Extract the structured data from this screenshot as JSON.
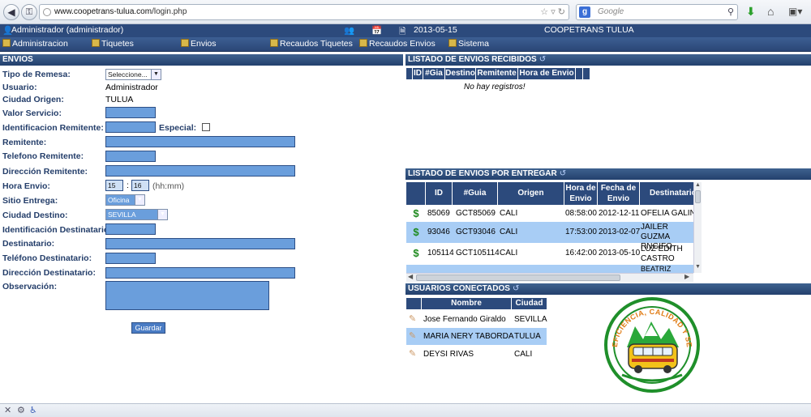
{
  "browser": {
    "url_host": "www.coopetrans-tulua.com",
    "url_path": "/login.php",
    "search_placeholder": "Google",
    "search_engine_letter": "g"
  },
  "header": {
    "user": "Administrador (administrador)",
    "date": "2013-05-15",
    "company": "COOPETRANS TULUA"
  },
  "menu": {
    "items": [
      {
        "label": "Administracion"
      },
      {
        "label": "Tiquetes"
      },
      {
        "label": "Envios"
      },
      {
        "label": "Recaudos Tiquetes"
      },
      {
        "label": "Recaudos Envios"
      },
      {
        "label": "Sistema"
      }
    ]
  },
  "form": {
    "title": "ENVIOS",
    "tipo_remesa_label": "Tipo de Remesa:",
    "tipo_remesa_value": "Seleccione...",
    "usuario_label": "Usuario:",
    "usuario_value": "Administrador",
    "ciudad_origen_label": "Ciudad Origen:",
    "ciudad_origen_value": "TULUA",
    "valor_servicio_label": "Valor Servicio:",
    "identificacion_remitente_label": "Identificacion Remitente:",
    "especial_label": "Especial:",
    "remitente_label": "Remitente:",
    "telefono_remitente_label": "Telefono Remitente:",
    "direccion_remitente_label": "Dirección Remitente:",
    "hora_envio_label": "Hora Envio:",
    "hora_value": "15",
    "minuto_value": "16",
    "hora_separator": ":",
    "hora_format": "(hh:mm)",
    "sitio_entrega_label": "Sitio Entrega:",
    "sitio_entrega_value": "Oficina",
    "ciudad_destino_label": "Ciudad Destino:",
    "ciudad_destino_value": "SEVILLA",
    "identificacion_destinatario_label": "Identificación Destinatario:",
    "destinatario_label": "Destinatario:",
    "telefono_destinatario_label": "Teléfono Destinatario:",
    "direccion_destinatario_label": "Dirección Destinatario:",
    "observacion_label": "Observación:",
    "guardar_label": "Guardar"
  },
  "recibidos": {
    "title": "LISTADO DE ENVIOS RECIBIDOS",
    "columns": [
      "ID",
      "#Gia",
      "Destino",
      "Remitente",
      "Hora de Envio"
    ],
    "empty_text": "No hay registros!"
  },
  "por_entregar": {
    "title": "LISTADO DE ENVIOS POR ENTREGAR",
    "columns": [
      "ID",
      "#Guia",
      "Origen",
      "Hora de Envio",
      "Fecha de Envio",
      "Destinatario"
    ],
    "rows": [
      {
        "id": "85069",
        "guia": "GCT85069",
        "origen": "CALI",
        "hora": "08:58:00",
        "fecha": "2012-12-11",
        "dest": "OFELIA GALIN"
      },
      {
        "id": "93046",
        "guia": "GCT93046",
        "origen": "CALI",
        "hora": "17:53:00",
        "fecha": "2013-02-07",
        "dest": "JAILER GUZMA RNGIFO"
      },
      {
        "id": "105114",
        "guia": "GCT105114",
        "origen": "CALI",
        "hora": "16:42:00",
        "fecha": "2013-05-10",
        "dest": "LUZ EDITH CASTRO"
      },
      {
        "id": "",
        "guia": "",
        "origen": "",
        "hora": "",
        "fecha": "",
        "dest": "BEATRIZ"
      }
    ]
  },
  "usuarios": {
    "title": "USUARIOS CONECTADOS",
    "columns": [
      "Nombre",
      "Ciudad"
    ],
    "rows": [
      {
        "nombre": "Jose Fernando Giraldo",
        "ciudad": "SEVILLA"
      },
      {
        "nombre": "MARIA NERY TABORDA",
        "ciudad": "TULUA"
      },
      {
        "nombre": "DEYSI RIVAS",
        "ciudad": "CALI"
      }
    ]
  },
  "logo": {
    "text": "EFICIENCIA, CALIDAD Y SEGURIDAD"
  },
  "colors": {
    "header": "#2c4a7c",
    "input_fill": "#6a9edc",
    "row_highlight": "#a8cdf5",
    "dollar": "#1e8a1e"
  }
}
